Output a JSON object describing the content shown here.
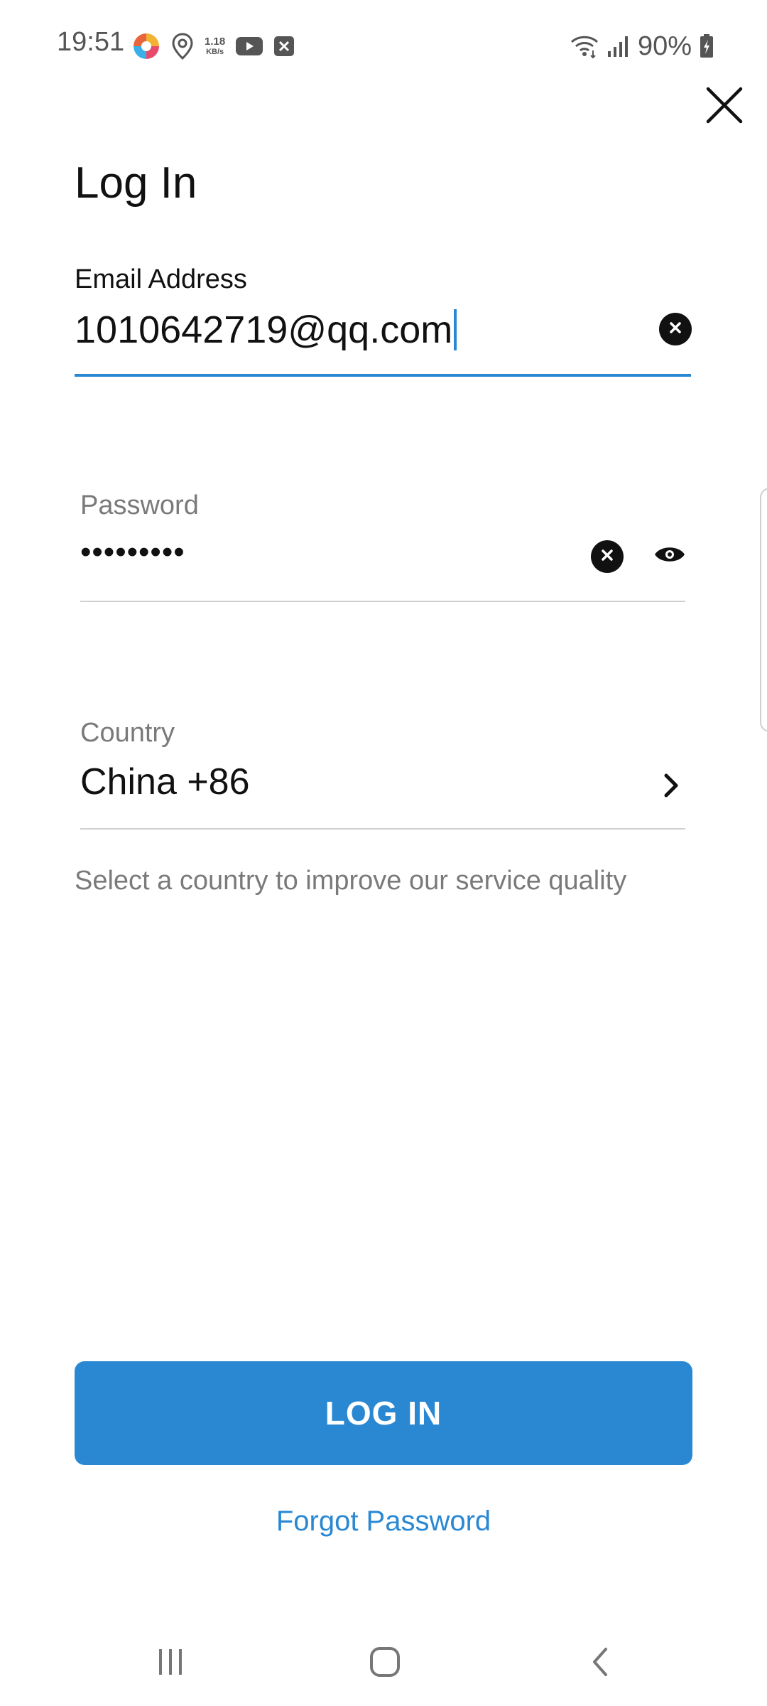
{
  "status_bar": {
    "time": "19:51",
    "net_speed_value": "1.18",
    "net_speed_unit": "KB/s",
    "battery": "90%",
    "icons_left": [
      "app-logo-icon",
      "location-icon",
      "network-speed-icon",
      "youtube-icon",
      "notification-x-icon"
    ],
    "icons_right": [
      "wifi-icon",
      "signal-icon",
      "battery-charging-icon"
    ]
  },
  "header": {
    "title": "Log In",
    "close_icon": "close-icon"
  },
  "form": {
    "email": {
      "label": "Email Address",
      "value": "1010642719@qq.com"
    },
    "password": {
      "label": "Password",
      "masked_value": "•••••••••"
    },
    "country": {
      "label": "Country",
      "value": "China +86",
      "hint": "Select a country to improve our service quality"
    }
  },
  "actions": {
    "login_label": "LOG IN",
    "forgot_label": "Forgot Password"
  },
  "colors": {
    "accent": "#2a88d3",
    "muted_text": "#7a7a7a",
    "divider": "#d0d0d0"
  }
}
